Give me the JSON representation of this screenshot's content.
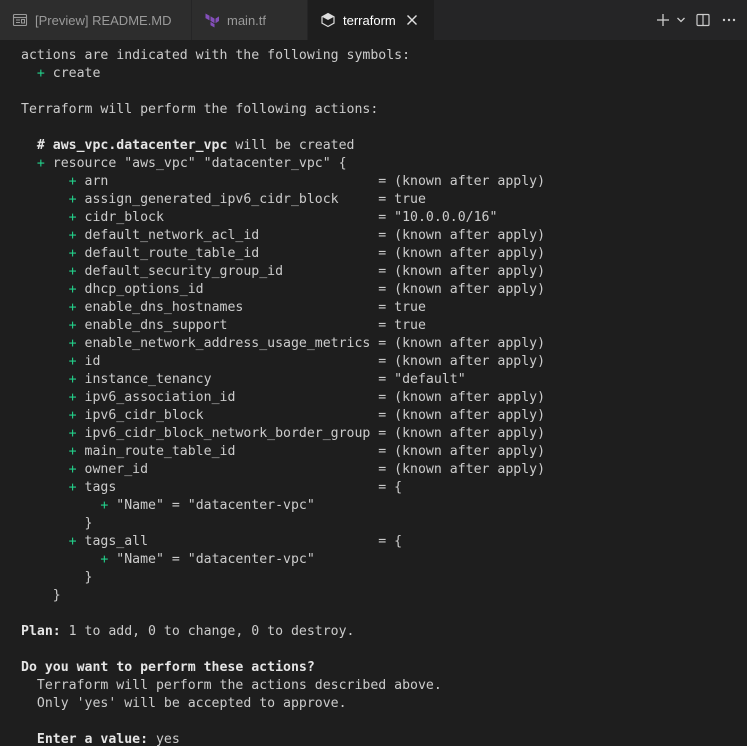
{
  "tabs": [
    {
      "label": "[Preview] README.MD",
      "icon": "preview-icon",
      "active": false
    },
    {
      "label": "main.tf",
      "icon": "terraform-icon",
      "active": false
    },
    {
      "label": "terraform",
      "icon": "terminal-icon",
      "active": true
    }
  ],
  "toolbar_icons": [
    "new-terminal-icon",
    "chevron-down-icon",
    "split-terminal-icon",
    "more-icon"
  ],
  "colors": {
    "background": "#1e1e1e",
    "tab_bar": "#252526",
    "plus": "#23d18b",
    "text": "#cccccc",
    "terraform_purple": "#844fba"
  },
  "terminal": {
    "lines": [
      {
        "t": "actions are indicated with the following symbols:"
      },
      {
        "pre": "  ",
        "plus": "+",
        "t": " create"
      },
      {
        "t": ""
      },
      {
        "t": "Terraform will perform the following actions:"
      },
      {
        "t": ""
      },
      {
        "pre": "  ",
        "b": "# aws_vpc.datacenter_vpc",
        "t": " will be created"
      },
      {
        "pre": "  ",
        "plus": "+",
        "t": " resource \"aws_vpc\" \"datacenter_vpc\" {"
      },
      {
        "pre": "      ",
        "plus": "+",
        "t": " arn                                  = (known after apply)"
      },
      {
        "pre": "      ",
        "plus": "+",
        "t": " assign_generated_ipv6_cidr_block     = true"
      },
      {
        "pre": "      ",
        "plus": "+",
        "t": " cidr_block                           = \"10.0.0.0/16\""
      },
      {
        "pre": "      ",
        "plus": "+",
        "t": " default_network_acl_id               = (known after apply)"
      },
      {
        "pre": "      ",
        "plus": "+",
        "t": " default_route_table_id               = (known after apply)"
      },
      {
        "pre": "      ",
        "plus": "+",
        "t": " default_security_group_id            = (known after apply)"
      },
      {
        "pre": "      ",
        "plus": "+",
        "t": " dhcp_options_id                      = (known after apply)"
      },
      {
        "pre": "      ",
        "plus": "+",
        "t": " enable_dns_hostnames                 = true"
      },
      {
        "pre": "      ",
        "plus": "+",
        "t": " enable_dns_support                   = true"
      },
      {
        "pre": "      ",
        "plus": "+",
        "t": " enable_network_address_usage_metrics = (known after apply)"
      },
      {
        "pre": "      ",
        "plus": "+",
        "t": " id                                   = (known after apply)"
      },
      {
        "pre": "      ",
        "plus": "+",
        "t": " instance_tenancy                     = \"default\""
      },
      {
        "pre": "      ",
        "plus": "+",
        "t": " ipv6_association_id                  = (known after apply)"
      },
      {
        "pre": "      ",
        "plus": "+",
        "t": " ipv6_cidr_block                      = (known after apply)"
      },
      {
        "pre": "      ",
        "plus": "+",
        "t": " ipv6_cidr_block_network_border_group = (known after apply)"
      },
      {
        "pre": "      ",
        "plus": "+",
        "t": " main_route_table_id                  = (known after apply)"
      },
      {
        "pre": "      ",
        "plus": "+",
        "t": " owner_id                             = (known after apply)"
      },
      {
        "pre": "      ",
        "plus": "+",
        "t": " tags                                 = {"
      },
      {
        "pre": "          ",
        "plus": "+",
        "t": " \"Name\" = \"datacenter-vpc\""
      },
      {
        "pre": "        ",
        "t": "}"
      },
      {
        "pre": "      ",
        "plus": "+",
        "t": " tags_all                             = {"
      },
      {
        "pre": "          ",
        "plus": "+",
        "t": " \"Name\" = \"datacenter-vpc\""
      },
      {
        "pre": "        ",
        "t": "}"
      },
      {
        "pre": "    ",
        "t": "}"
      },
      {
        "t": ""
      },
      {
        "b": "Plan:",
        "t": " 1 to add, 0 to change, 0 to destroy."
      },
      {
        "t": ""
      },
      {
        "b": "Do you want to perform these actions?"
      },
      {
        "pre": "  ",
        "t": "Terraform will perform the actions described above."
      },
      {
        "pre": "  ",
        "t": "Only 'yes' will be accepted to approve."
      },
      {
        "t": ""
      },
      {
        "pre": "  ",
        "b": "Enter a value:",
        "t": " yes"
      }
    ]
  }
}
